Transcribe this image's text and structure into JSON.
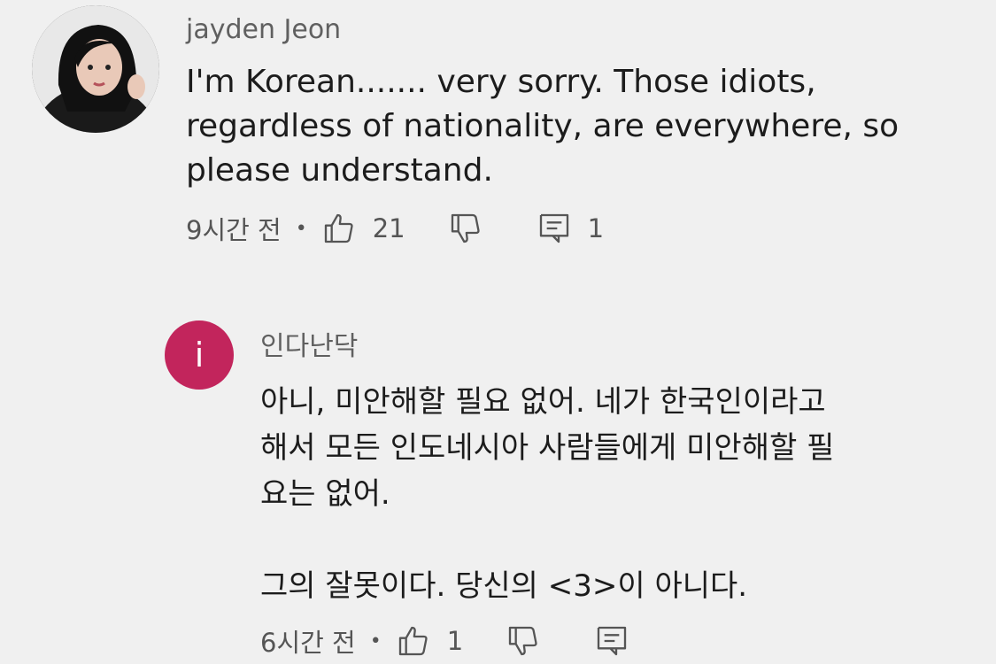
{
  "comments": [
    {
      "author": "jayden Jeon",
      "text": "I'm Korean....... very sorry. Those idiots,\nregardless of nationality, are everywhere, so\nplease understand.",
      "time": "9시간 전",
      "dot": "•",
      "likes": "21",
      "replies": "1"
    },
    {
      "author": "인다난닥",
      "avatar_letter": "i",
      "avatar_color": "#c2255c",
      "text": "아니, 미안해할 필요 없어. 네가 한국인이라고\n해서 모든 인도네시아 사람들에게 미안해할 필\n요는 없어.\n\n그의 잘못이다. 당신의 <3>이 아니다.",
      "time": "6시간 전",
      "dot": "•",
      "likes": "1"
    }
  ],
  "icons": {
    "like": "thumbs-up-icon",
    "dislike": "thumbs-down-icon",
    "reply": "comment-icon"
  }
}
